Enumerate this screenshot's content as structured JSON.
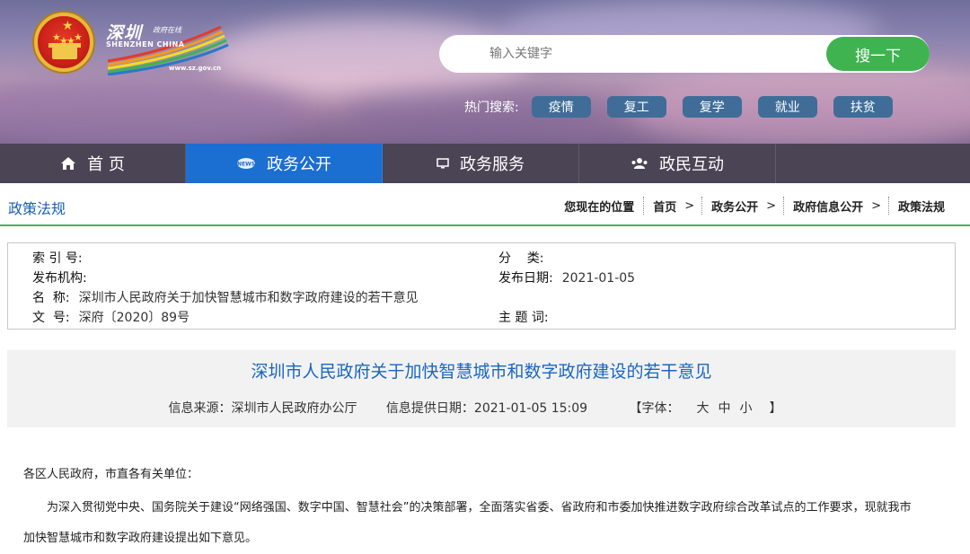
{
  "header": {
    "site_name_cn": "深圳",
    "site_tagline": "政府在线",
    "site_name_en": "SHENZHEN CHINA",
    "site_url": "www.sz.gov.cn",
    "search": {
      "placeholder": "输入关键字",
      "button_label": "搜一下"
    },
    "hot_search": {
      "label": "热门搜索:",
      "tags": [
        "疫情",
        "复工",
        "复学",
        "就业",
        "扶贫"
      ]
    }
  },
  "nav": {
    "items": [
      {
        "label": "首 页",
        "icon": "home-icon",
        "active": false
      },
      {
        "label": "政务公开",
        "icon": "news-icon",
        "active": true
      },
      {
        "label": "政务服务",
        "icon": "monitor-icon",
        "active": false
      },
      {
        "label": "政民互动",
        "icon": "people-icon",
        "active": false
      },
      {
        "label": "",
        "icon": "",
        "active": false
      }
    ]
  },
  "breadcrumb": {
    "section_title": "政策法规",
    "prefix": "您现在的位置",
    "items": [
      "首页",
      "政务公开",
      "政府信息公开",
      "政策法规"
    ]
  },
  "meta": {
    "index_label": "索 引 号:",
    "index_value": "",
    "publisher_label": "发布机构:",
    "publisher_value": "",
    "name_label": "名  称:",
    "name_value": "深圳市人民政府关于加快智慧城市和数字政府建设的若干意见",
    "doc_no_label": "文  号:",
    "doc_no_value": "深府〔2020〕89号",
    "category_label": "分    类:",
    "category_value": "",
    "date_label": "发布日期:",
    "date_value": "2021-01-05",
    "subject_label": "主 题 词:",
    "subject_value": ""
  },
  "article": {
    "title": "深圳市人民政府关于加快智慧城市和数字政府建设的若干意见",
    "source": "信息来源：深圳市人民政府办公厅",
    "provided_date": "信息提供日期：2021-01-05 15:09",
    "font_label_open": "【字体：",
    "font_sizes": [
      "大",
      "中",
      "小"
    ],
    "font_label_close": "】",
    "salutation": "各区人民政府，市直各有关单位：",
    "paragraph_1a": "为深入贯彻党中央、国务院关于建设“网络强国、数字中国、智慧社会”的决策部署，全面落实省委、省政府和市委加快推进数字政府综合改革试点的工作要求，现就我市",
    "paragraph_1b": "加快智慧城市和数字政府建设提出如下意见。"
  },
  "colors": {
    "nav_active": "#1b6ed2",
    "search_button": "#3fb34f",
    "hot_tag": "#3f6d98",
    "title_blue": "#1a66c2",
    "divider_green": "#45b257"
  }
}
